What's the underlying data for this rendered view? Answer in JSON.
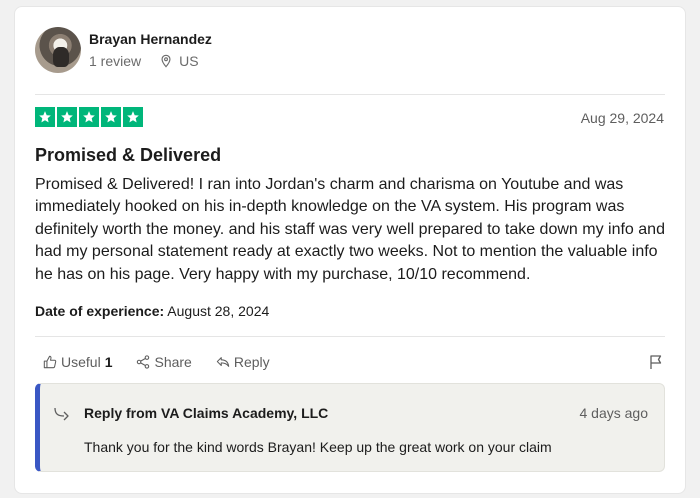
{
  "reviewer": {
    "name": "Brayan Hernandez",
    "reviews": "1 review",
    "country": "US"
  },
  "review": {
    "rating": 5,
    "date": "Aug 29, 2024",
    "title": "Promised & Delivered",
    "text": "Promised & Delivered! I ran into Jordan's charm and charisma on Youtube and was immediately hooked on his in-depth knowledge on the VA system. His program was definitely worth the money. and his staff was very well prepared to take down my info and had my personal statement ready at exactly two weeks. Not to mention the valuable info he has on his page. Very happy with my purchase, 10/10 recommend.",
    "experience_label": "Date of experience:",
    "experience_date": "August 28, 2024"
  },
  "actions": {
    "useful_label": "Useful",
    "useful_count": "1",
    "share_label": "Share",
    "reply_label": "Reply"
  },
  "reply": {
    "from": "Reply from VA Claims Academy, LLC",
    "date": "4 days ago",
    "text": "Thank you for the kind words Brayan! Keep up the great work on your claim"
  },
  "colors": {
    "star_green": "#00b67a",
    "reply_accent": "#3a57c4"
  },
  "icons": [
    "location-pin-icon",
    "star-icon",
    "thumbs-up-icon",
    "share-icon",
    "reply-icon",
    "flag-icon",
    "reply-arrow-icon"
  ]
}
